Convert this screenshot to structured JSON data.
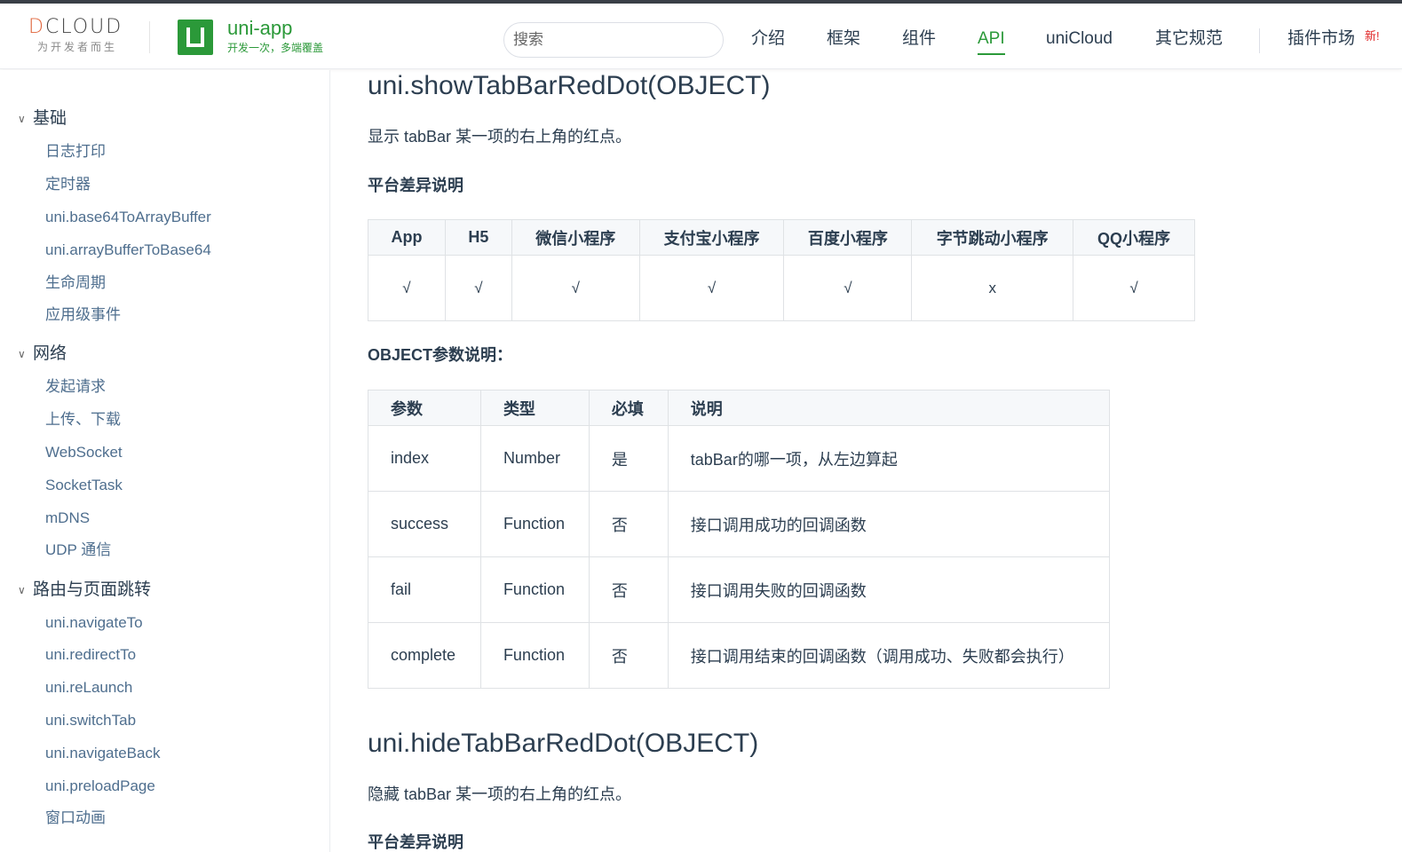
{
  "header": {
    "dcloud_logo": "DCLOUD",
    "dcloud_slogan": "为开发者而生",
    "uniapp_title": "uni-app",
    "uniapp_subtitle": "开发一次，多端覆盖",
    "search_placeholder": "搜索",
    "nav": [
      {
        "label": "介绍",
        "active": false
      },
      {
        "label": "框架",
        "active": false
      },
      {
        "label": "组件",
        "active": false
      },
      {
        "label": "API",
        "active": true
      },
      {
        "label": "uniCloud",
        "active": false
      },
      {
        "label": "其它规范",
        "active": false
      },
      {
        "label": "插件市场",
        "active": false
      }
    ],
    "new_badge": "新!",
    "accent_color": "#2b9939"
  },
  "sidebar": {
    "groups": [
      {
        "label": "基础",
        "items": [
          "日志打印",
          "定时器",
          "uni.base64ToArrayBuffer",
          "uni.arrayBufferToBase64",
          "生命周期",
          "应用级事件"
        ]
      },
      {
        "label": "网络",
        "items": [
          "发起请求",
          "上传、下载",
          "WebSocket",
          "SocketTask",
          "mDNS",
          "UDP 通信"
        ]
      },
      {
        "label": "路由与页面跳转",
        "items": [
          "uni.navigateTo",
          "uni.redirectTo",
          "uni.reLaunch",
          "uni.switchTab",
          "uni.navigateBack",
          "uni.preloadPage",
          "窗口动画"
        ]
      }
    ]
  },
  "main": {
    "section1": {
      "title": "uni.showTabBarRedDot(OBJECT)",
      "desc": "显示 tabBar 某一项的右上角的红点。",
      "platform_heading": "平台差异说明",
      "platform_table": {
        "headers": [
          "App",
          "H5",
          "微信小程序",
          "支付宝小程序",
          "百度小程序",
          "字节跳动小程序",
          "QQ小程序"
        ],
        "row": [
          "√",
          "√",
          "√",
          "√",
          "√",
          "x",
          "√"
        ]
      },
      "param_heading": "OBJECT参数说明：",
      "param_table": {
        "headers": [
          "参数",
          "类型",
          "必填",
          "说明"
        ],
        "rows": [
          [
            "index",
            "Number",
            "是",
            "tabBar的哪一项，从左边算起"
          ],
          [
            "success",
            "Function",
            "否",
            "接口调用成功的回调函数"
          ],
          [
            "fail",
            "Function",
            "否",
            "接口调用失败的回调函数"
          ],
          [
            "complete",
            "Function",
            "否",
            "接口调用结束的回调函数（调用成功、失败都会执行）"
          ]
        ]
      }
    },
    "section2": {
      "title": "uni.hideTabBarRedDot(OBJECT)",
      "desc": "隐藏 tabBar 某一项的右上角的红点。",
      "platform_heading": "平台差异说明"
    }
  }
}
